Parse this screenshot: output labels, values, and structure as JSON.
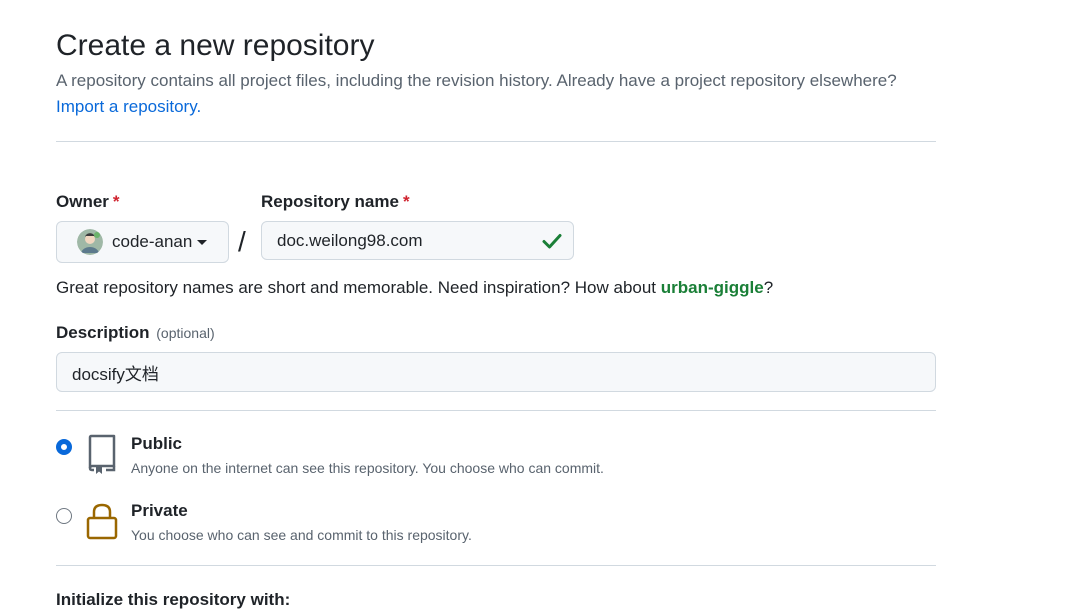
{
  "header": {
    "title": "Create a new repository",
    "subtitle": "A repository contains all project files, including the revision history. Already have a project repository elsewhere?",
    "import_link": "Import a repository."
  },
  "owner": {
    "label": "Owner",
    "required_mark": "*",
    "value": "code-anan"
  },
  "repo_name": {
    "label": "Repository name",
    "required_mark": "*",
    "value": "doc.weilong98.com",
    "valid": true
  },
  "name_hint": {
    "text": "Great repository names are short and memorable. Need inspiration? How about ",
    "suggestion": "urban-giggle",
    "suffix": "?"
  },
  "description": {
    "label": "Description",
    "optional": "(optional)",
    "value": "docsify文档"
  },
  "visibility": {
    "selected": "public",
    "options": [
      {
        "title": "Public",
        "desc": "Anyone on the internet can see this repository. You choose who can commit.",
        "icon": "repo-icon"
      },
      {
        "title": "Private",
        "desc": "You choose who can see and commit to this repository.",
        "icon": "lock-icon"
      }
    ]
  },
  "initialize": {
    "label": "Initialize this repository with:"
  },
  "colors": {
    "accent": "#0969da",
    "success": "#1a7f37",
    "danger": "#cf222e",
    "private_icon": "#9a6700"
  }
}
